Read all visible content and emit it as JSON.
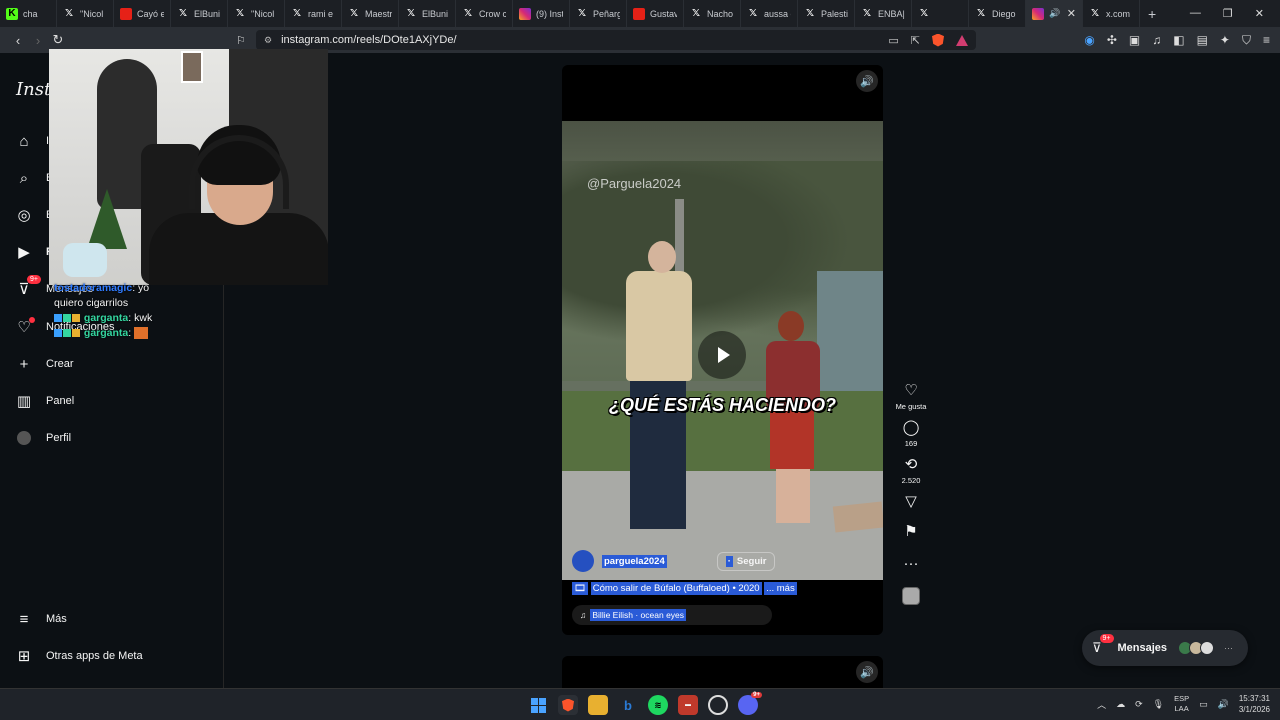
{
  "browser": {
    "tabs": [
      {
        "title": "cha",
        "icon": "kick-icon"
      },
      {
        "title": "\"Nicol",
        "icon": "x-icon"
      },
      {
        "title": "Cayó e",
        "icon": "youtube-icon"
      },
      {
        "title": "ElBuni",
        "icon": "x-icon"
      },
      {
        "title": "\"Nicol",
        "icon": "x-icon"
      },
      {
        "title": "rami e",
        "icon": "x-icon"
      },
      {
        "title": "Maestr",
        "icon": "x-icon"
      },
      {
        "title": "ElBuni",
        "icon": "x-icon"
      },
      {
        "title": "Crow c",
        "icon": "x-icon"
      },
      {
        "title": "(9) Inst",
        "icon": "instagram-icon"
      },
      {
        "title": "Peñarg",
        "icon": "x-icon"
      },
      {
        "title": "Gustav",
        "icon": "youtube-icon"
      },
      {
        "title": "Nacho",
        "icon": "x-icon"
      },
      {
        "title": "aussa c",
        "icon": "x-icon"
      },
      {
        "title": "Palesti",
        "icon": "x-icon"
      },
      {
        "title": "ENBA|",
        "icon": "x-icon"
      },
      {
        "title": "",
        "icon": "x-icon"
      },
      {
        "title": "Diego",
        "icon": "x-icon"
      },
      {
        "title": "",
        "icon": "instagram-icon",
        "active": true
      },
      {
        "title": "x.com",
        "icon": "x-icon"
      }
    ],
    "url": "instagram.com/reels/DOte1AXjYDe/"
  },
  "sidebar": {
    "logo": "Insta",
    "items": [
      {
        "label": "In",
        "icon": "home-icon"
      },
      {
        "label": "B",
        "icon": "search-icon"
      },
      {
        "label": "E",
        "icon": "explore-icon"
      },
      {
        "label": "R",
        "icon": "reels-icon"
      },
      {
        "label": "Mensajes",
        "icon": "messenger-icon",
        "badge": "9+"
      },
      {
        "label": "Notificaciones",
        "icon": "heart-icon"
      },
      {
        "label": "Crear",
        "icon": "plus-icon"
      },
      {
        "label": "Panel",
        "icon": "chart-icon"
      },
      {
        "label": "Perfil",
        "icon": "avatar"
      }
    ],
    "more": "Más",
    "meta_apps": "Otras apps de Meta"
  },
  "chat": [
    {
      "user": "tostadoramagic",
      "text": "yo"
    },
    {
      "user": "",
      "text": "quiero cigarrilos"
    },
    {
      "user": "garganta",
      "text": "kwk"
    },
    {
      "user": "garganta",
      "text": ""
    }
  ],
  "reel": {
    "watermark": "@Parguela2024",
    "subtitle": "¿QUÉ ESTÁS HACIENDO?",
    "author": "parguela2024",
    "follow": "Seguir",
    "caption": "Cómo salir de Búfalo (Buffaloed) • 2020",
    "caption_more": "... más",
    "music": "Billie Eilish · ocean eyes",
    "likes_label": "Me gusta",
    "comments": "169",
    "shares": "2.520"
  },
  "messages_pill": {
    "label": "Mensajes",
    "badge": "9+"
  },
  "taskbar": {
    "lang_top": "ESP",
    "lang_bottom": "LAA",
    "time": "15:37:31",
    "date": "3/1/2026",
    "discord_badge": "9+"
  }
}
